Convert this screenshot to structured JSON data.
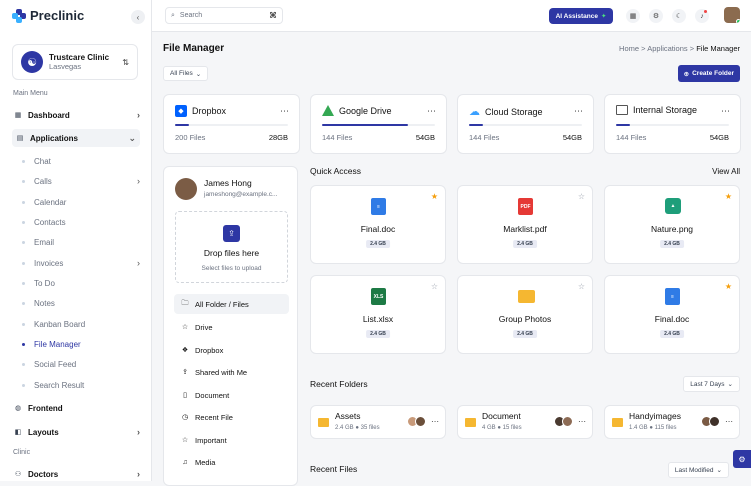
{
  "brand": {
    "name": "Preclinic",
    "accent": "#2e37a4"
  },
  "clinic": {
    "name": "Trustcare Clinic",
    "location": "Lasvegas"
  },
  "sidebar": {
    "main_menu_title": "Main Menu",
    "dashboard": "Dashboard",
    "applications": "Applications",
    "sub_items": [
      "Chat",
      "Calls",
      "Calendar",
      "Contacts",
      "Email",
      "Invoices",
      "To Do",
      "Notes",
      "Kanban Board",
      "File Manager",
      "Social Feed",
      "Search Result"
    ],
    "frontend": "Frontend",
    "layouts": "Layouts",
    "clinic_title": "Clinic",
    "doctors": "Doctors"
  },
  "topbar": {
    "search_placeholder": "Search",
    "ai_label": "AI Assistance"
  },
  "page": {
    "title": "File Manager",
    "crumbs": [
      "Home",
      "Applications"
    ],
    "crumb_current": "File Manager",
    "filter_label": "All Files",
    "create_label": "Create Folder"
  },
  "storage": [
    {
      "name": "Dropbox",
      "files": "200 Files",
      "size": "28GB",
      "fill": 0.12,
      "color": "#0061fe"
    },
    {
      "name": "Google Drive",
      "files": "144 Files",
      "size": "54GB",
      "fill": 0.76,
      "color": "#34a853"
    },
    {
      "name": "Cloud Storage",
      "files": "144 Files",
      "size": "54GB",
      "fill": 0.12,
      "color": "#3aa0ff"
    },
    {
      "name": "Internal Storage",
      "files": "144 Files",
      "size": "54GB",
      "fill": 0.12,
      "color": "#555"
    }
  ],
  "profile": {
    "name": "James Hong",
    "email": "jameshong@example.c..."
  },
  "dropzone": {
    "title": "Drop files here",
    "subtitle": "Select files to upload"
  },
  "folder_nav": [
    "All Folder / Files",
    "Drive",
    "Dropbox",
    "Shared with Me",
    "Document",
    "Recent File",
    "Important",
    "Media"
  ],
  "quick_access": {
    "title": "Quick Access",
    "view_all": "View All",
    "files": [
      {
        "name": "Final.doc",
        "size": "2.4 GB",
        "starred": true,
        "kind": "doc",
        "color": "#2f7be6"
      },
      {
        "name": "Marklist.pdf",
        "size": "2.4 GB",
        "starred": false,
        "kind": "PDF",
        "color": "#e53935"
      },
      {
        "name": "Nature.png",
        "size": "2.4 GB",
        "starred": true,
        "kind": "img",
        "color": "#1e9e7a"
      },
      {
        "name": "List.xlsx",
        "size": "2.4 GB",
        "starred": false,
        "kind": "XLS",
        "color": "#1d7a45"
      },
      {
        "name": "Group Photos",
        "size": "2.4 GB",
        "starred": false,
        "kind": "folder",
        "color": "#f5b731"
      },
      {
        "name": "Final.doc",
        "size": "2.4 GB",
        "starred": true,
        "kind": "doc",
        "color": "#2f7be6"
      }
    ]
  },
  "recent_folders": {
    "title": "Recent Folders",
    "filter": "Last 7 Days",
    "items": [
      {
        "name": "Assets",
        "meta": "2.4 GB ● 35 files"
      },
      {
        "name": "Document",
        "meta": "4 GB ● 15 files"
      },
      {
        "name": "Handyimages",
        "meta": "1.4 GB ● 115 files"
      }
    ]
  },
  "recent_files": {
    "title": "Recent Files",
    "filter": "Last Modified"
  }
}
